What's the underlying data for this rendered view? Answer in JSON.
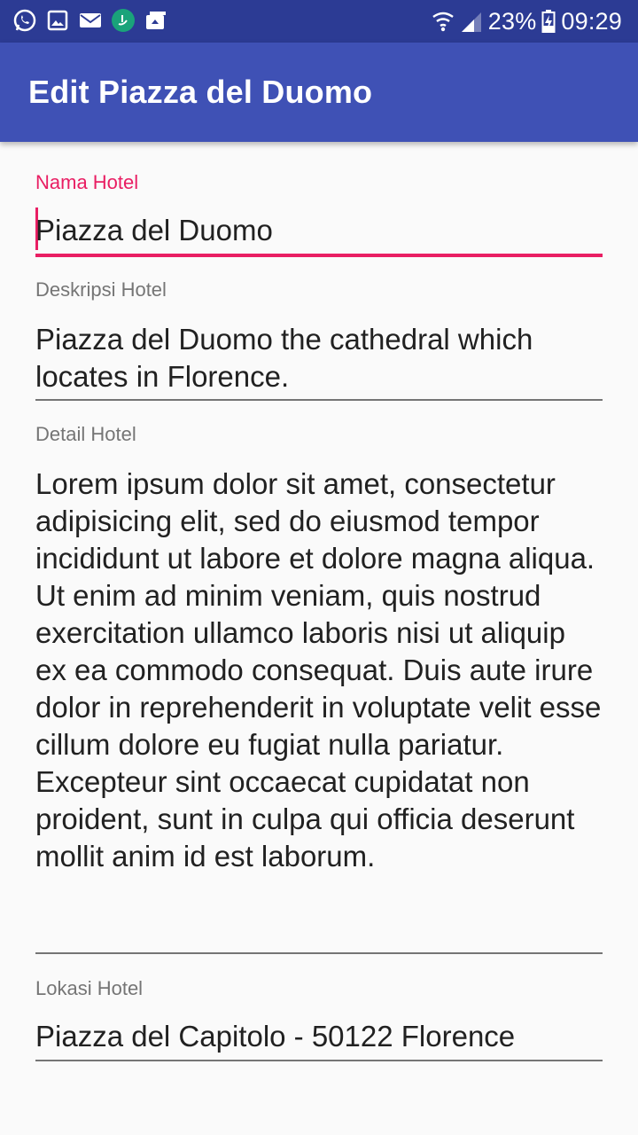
{
  "status_bar": {
    "icons": [
      "whatsapp-icon",
      "gallery-icon",
      "mail-icon",
      "app-badge-icon",
      "photo-share-icon"
    ],
    "battery": "23%",
    "time": "09:29"
  },
  "app_bar": {
    "title": "Edit Piazza del Duomo",
    "color": "#3f51b5",
    "status_color": "#2c3b94"
  },
  "form": {
    "accent_color": "#e91e63",
    "nama": {
      "label": "Nama Hotel",
      "value": "Piazza del Duomo"
    },
    "deskripsi": {
      "label": "Deskripsi Hotel",
      "value": "Piazza del Duomo the cathedral which locates in Florence."
    },
    "detail": {
      "label": "Detail Hotel",
      "value": "Lorem ipsum dolor sit amet, consectetur adipisicing elit, sed do eiusmod tempor incididunt ut labore et dolore magna aliqua. Ut enim ad minim veniam, quis nostrud exercitation ullamco laboris nisi ut aliquip ex ea commodo consequat. Duis aute irure dolor in reprehenderit in voluptate velit esse cillum dolore eu fugiat nulla pariatur. Excepteur sint occaecat cupidatat non proident, sunt in culpa qui officia deserunt mollit anim id est laborum."
    },
    "lokasi": {
      "label": "Lokasi Hotel",
      "value": "Piazza del Capitolo - 50122 Florence"
    }
  }
}
